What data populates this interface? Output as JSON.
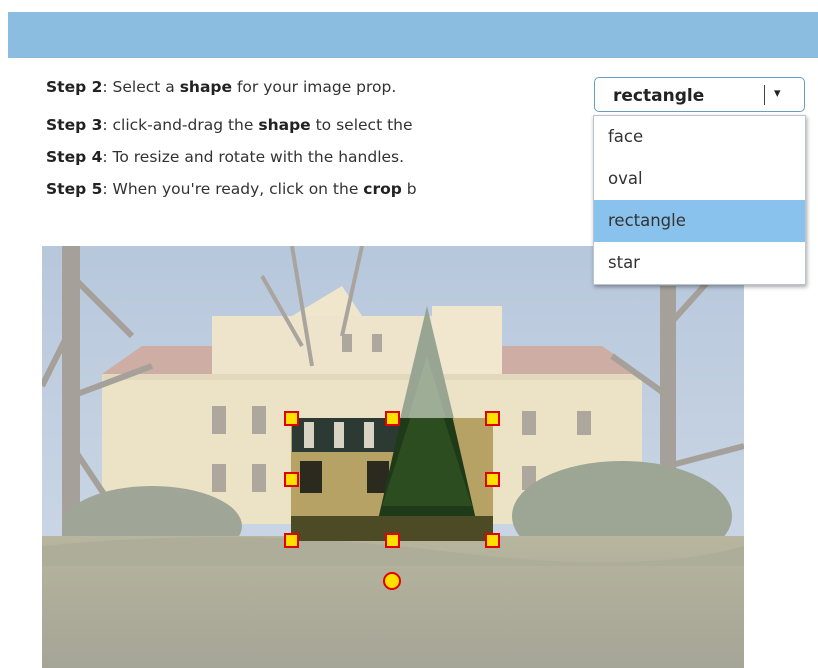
{
  "steps": [
    {
      "label": "Step 2",
      "text1": ": Select a ",
      "bold": "shape",
      "text2": " for your image prop."
    },
    {
      "label": "Step 3",
      "text1": ": click-and-drag the ",
      "bold": "shape",
      "text2": " to select the"
    },
    {
      "label": "Step 4",
      "text1": ": To resize and rotate with the handles.",
      "bold": "",
      "text2": ""
    },
    {
      "label": "Step 5",
      "text1": ": When you're ready, click on the ",
      "bold": "crop",
      "text2": " b"
    }
  ],
  "shape_select": {
    "value": "rectangle",
    "arrow": "▾",
    "options": [
      "face",
      "oval",
      "rectangle",
      "star"
    ],
    "selected_index": 2
  },
  "image": {
    "icon": "photo-image",
    "alt": ""
  },
  "colors": {
    "header_bar": "#8bbde0",
    "selected_option": "#89c2ec",
    "handle_fill": "#ffe100",
    "handle_border": "#e30000"
  }
}
